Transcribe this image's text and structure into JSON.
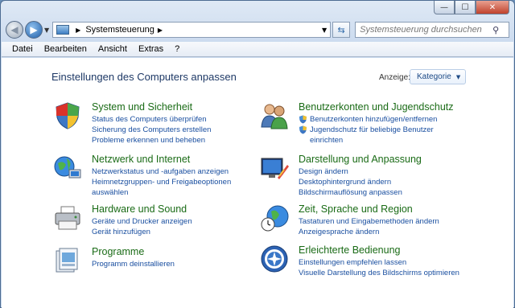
{
  "window": {
    "caption_buttons": {
      "minimize": "—",
      "maximize": "☐",
      "close": "✕"
    }
  },
  "address_bar": {
    "crumb": "Systemsteuerung",
    "search_placeholder": "Systemsteuerung durchsuchen"
  },
  "menubar": {
    "items": [
      "Datei",
      "Bearbeiten",
      "Ansicht",
      "Extras",
      "?"
    ]
  },
  "content": {
    "page_title": "Einstellungen des Computers anpassen",
    "view_label": "Anzeige:",
    "view_value": "Kategorie"
  },
  "categories": [
    {
      "title": "System und Sicherheit",
      "icon": "shield-icon",
      "links": [
        "Status des Computers überprüfen",
        "Sicherung des Computers erstellen",
        "Probleme erkennen und beheben"
      ]
    },
    {
      "title": "Netzwerk und Internet",
      "icon": "network-globe-icon",
      "links": [
        "Netzwerkstatus und -aufgaben anzeigen",
        "Heimnetzgruppen- und Freigabeoptionen",
        "auswählen"
      ]
    },
    {
      "title": "Hardware und Sound",
      "icon": "printer-icon",
      "links": [
        "Geräte und Drucker anzeigen",
        "Gerät hinzufügen"
      ]
    },
    {
      "title": "Programme",
      "icon": "programs-icon",
      "links": [
        "Programm deinstallieren"
      ]
    },
    {
      "title": "Benutzerkonten und Jugendschutz",
      "icon": "users-icon",
      "links": [
        "Benutzerkonten hinzufügen/entfernen",
        "Jugendschutz für beliebige Benutzer",
        "einrichten"
      ]
    },
    {
      "title": "Darstellung und Anpassung",
      "icon": "appearance-icon",
      "links": [
        "Design ändern",
        "Desktophintergrund ändern",
        "Bildschirmauflösung anpassen"
      ]
    },
    {
      "title": "Zeit, Sprache und Region",
      "icon": "clock-globe-icon",
      "links": [
        "Tastaturen und Eingabemethoden ändern",
        "Anzeigesprache ändern"
      ]
    },
    {
      "title": "Erleichterte Bedienung",
      "icon": "accessibility-icon",
      "links": [
        "Einstellungen empfehlen lassen",
        "Visuelle Darstellung des Bildschirms optimieren"
      ]
    }
  ]
}
